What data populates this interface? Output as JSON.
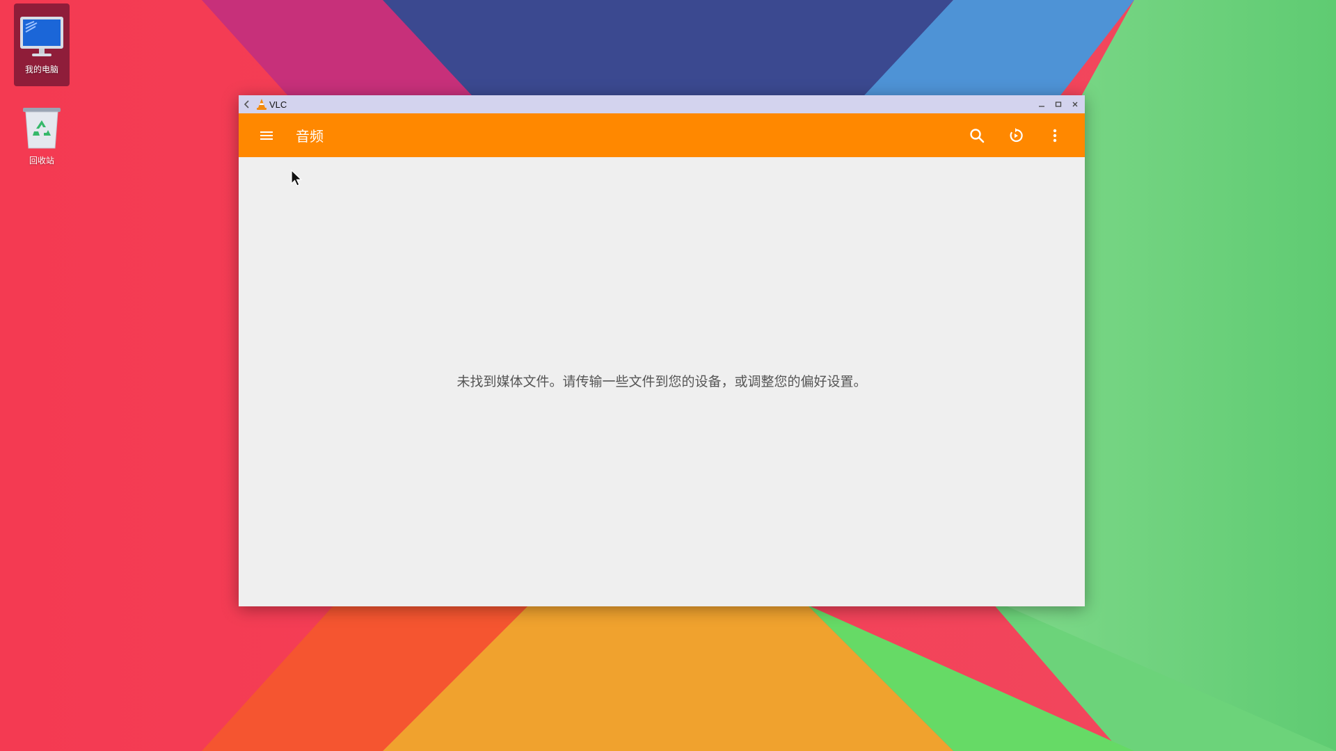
{
  "desktop": {
    "icons": [
      {
        "label": "我的电脑",
        "icon": "computer-monitor-icon",
        "selected": true
      },
      {
        "label": "回收站",
        "icon": "recycle-bin-icon",
        "selected": false
      }
    ]
  },
  "window": {
    "title": "VLC",
    "app_icon": "vlc-cone-icon",
    "controls": [
      "back-icon",
      "minimize-icon",
      "maximize-icon",
      "close-icon"
    ]
  },
  "appbar": {
    "title": "音频",
    "background": "#ff8800",
    "actions": [
      "search-icon",
      "refresh-play-icon",
      "more-vert-icon"
    ]
  },
  "content": {
    "empty_message": "未找到媒体文件。请传输一些文件到您的设备，或调整您的偏好设置。"
  }
}
